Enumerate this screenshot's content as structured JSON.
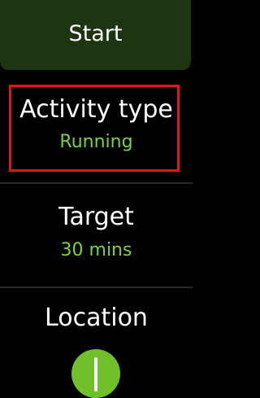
{
  "start": {
    "label": "Start"
  },
  "items": [
    {
      "title": "Activity type",
      "value": "Running"
    },
    {
      "title": "Target",
      "value": "30 mins"
    },
    {
      "title": "Location"
    }
  ],
  "icons": {
    "location": "location-toggle-icon"
  },
  "colors": {
    "accent": "#7bd437",
    "start_bg": "#1d3510",
    "highlight": "#e01818",
    "toggle": "#6fc02a"
  }
}
